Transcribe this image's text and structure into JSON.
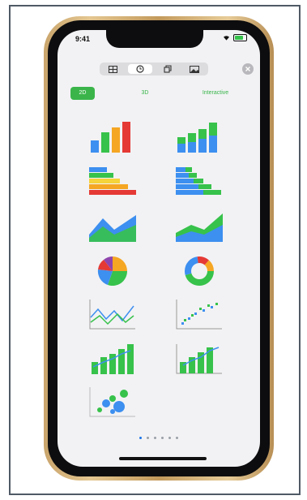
{
  "status_bar": {
    "time": "9:41"
  },
  "toolbar": {
    "segments": [
      {
        "icon": "table-icon",
        "active": false
      },
      {
        "icon": "clock-icon",
        "active": true
      },
      {
        "icon": "copy-icon",
        "active": false
      },
      {
        "icon": "image-icon",
        "active": false
      }
    ],
    "close_icon": "close-icon"
  },
  "tabs": [
    {
      "label": "2D",
      "active": true
    },
    {
      "label": "3D",
      "active": false
    },
    {
      "label": "Interactive",
      "active": false
    }
  ],
  "chart_icons": [
    "bar-chart-icon",
    "stacked-bar-chart-icon",
    "horizontal-bar-chart-icon",
    "horizontal-stacked-bar-chart-icon",
    "area-chart-icon",
    "stacked-area-chart-icon",
    "pie-chart-icon",
    "donut-chart-icon",
    "line-chart-icon",
    "scatter-chart-icon",
    "bar-line-combo-icon",
    "bar-line-combo-grid-icon",
    "bubble-chart-icon"
  ],
  "pagination": {
    "count": 6,
    "active_index": 0
  },
  "colors": {
    "accent_green": "#3bb54a",
    "blue": "#3d8ff0",
    "orange": "#f5a623",
    "red": "#e53935",
    "yellow": "#f5d33a"
  }
}
